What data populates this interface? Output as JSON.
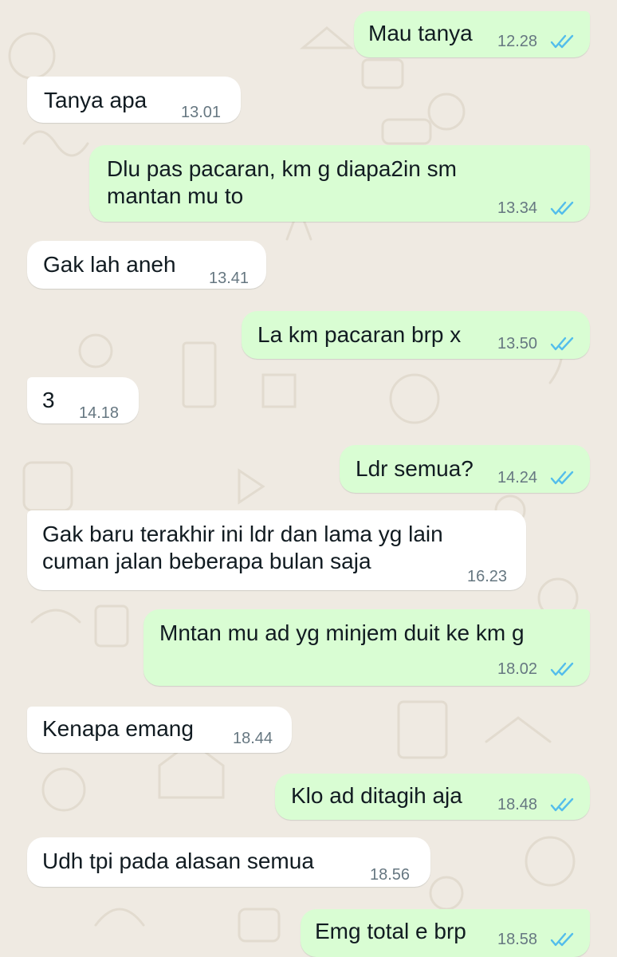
{
  "chat": {
    "messages": [
      {
        "dir": "out",
        "lines": [
          "Mau tanya"
        ],
        "time": "12.28",
        "read": true
      },
      {
        "dir": "in",
        "lines": [
          "Tanya apa"
        ],
        "time": "13.01"
      },
      {
        "dir": "out",
        "lines": [
          "Dlu pas pacaran, km g diapa2in sm",
          "mantan mu to"
        ],
        "time": "13.34",
        "read": true
      },
      {
        "dir": "in",
        "lines": [
          "Gak lah aneh"
        ],
        "time": "13.41"
      },
      {
        "dir": "out",
        "lines": [
          "La km pacaran brp x"
        ],
        "time": "13.50",
        "read": true
      },
      {
        "dir": "in",
        "lines": [
          "3"
        ],
        "time": "14.18"
      },
      {
        "dir": "out",
        "lines": [
          "Ldr semua?"
        ],
        "time": "14.24",
        "read": true
      },
      {
        "dir": "in",
        "lines": [
          "Gak baru terakhir ini ldr dan lama yg lain",
          "cuman jalan beberapa bulan saja"
        ],
        "time": "16.23"
      },
      {
        "dir": "out",
        "lines": [
          "Mntan mu ad yg minjem duit ke km g"
        ],
        "time": "18.02",
        "read": true
      },
      {
        "dir": "in",
        "lines": [
          "Kenapa emang"
        ],
        "time": "18.44"
      },
      {
        "dir": "out",
        "lines": [
          "Klo ad ditagih aja"
        ],
        "time": "18.48",
        "read": true
      },
      {
        "dir": "in",
        "lines": [
          "Udh tpi pada alasan semua"
        ],
        "time": "18.56"
      },
      {
        "dir": "out",
        "lines": [
          "Emg total e brp"
        ],
        "time": "18.58",
        "read": true
      }
    ]
  },
  "colors": {
    "wallpaper": "#efeae2",
    "outgoing_bubble": "#d9fdd3",
    "incoming_bubble": "#ffffff",
    "timestamp": "#667781",
    "read_ticks": "#53bdeb"
  },
  "icons": {
    "read_receipt": "double-check-icon"
  }
}
